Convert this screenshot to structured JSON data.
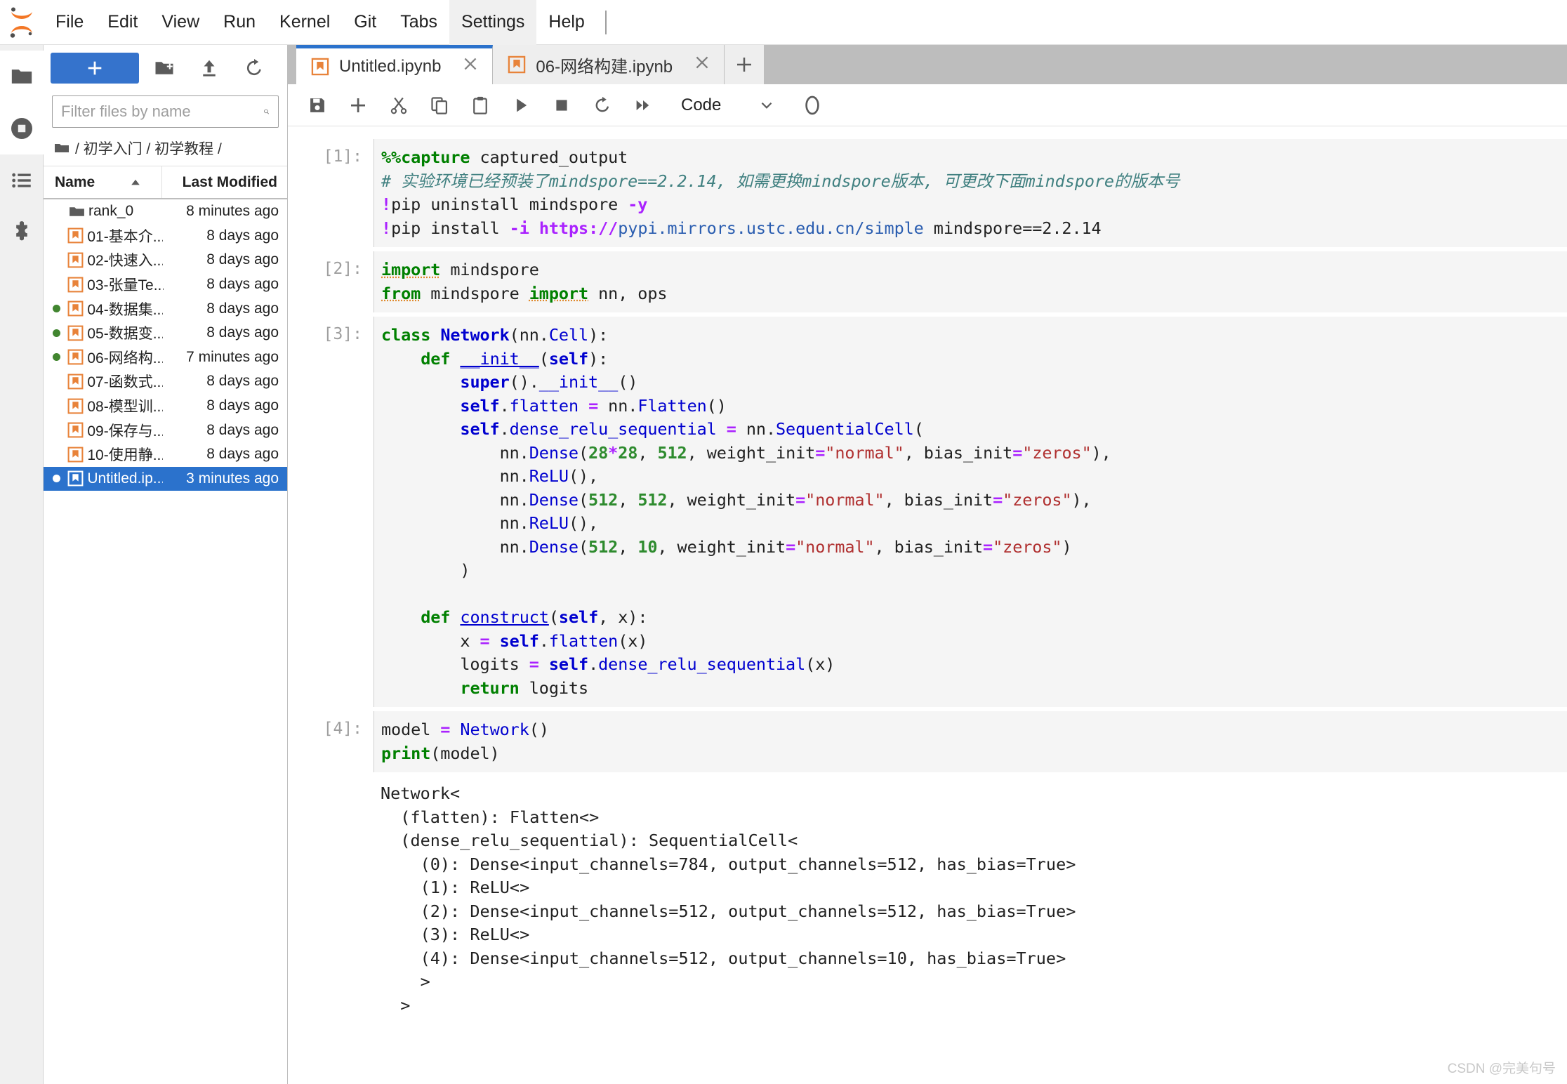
{
  "app": {
    "logo_icon": "jupyter-logo",
    "watermark": "CSDN @完美句号"
  },
  "menubar": {
    "items": [
      {
        "label": "File",
        "active": false
      },
      {
        "label": "Edit",
        "active": false
      },
      {
        "label": "View",
        "active": false
      },
      {
        "label": "Run",
        "active": false
      },
      {
        "label": "Kernel",
        "active": false
      },
      {
        "label": "Git",
        "active": false
      },
      {
        "label": "Tabs",
        "active": false
      },
      {
        "label": "Settings",
        "active": true
      },
      {
        "label": "Help",
        "active": false
      }
    ]
  },
  "activitybar": {
    "items": [
      {
        "name": "file-browser-icon",
        "label": "File Browser",
        "active": false
      },
      {
        "name": "running-kernels-icon",
        "label": "Running Terminals and Kernels",
        "active": true
      },
      {
        "name": "command-palette-icon",
        "label": "Commands",
        "active": false
      },
      {
        "name": "extension-manager-icon",
        "label": "Extension Manager",
        "active": false
      }
    ]
  },
  "filebrowser": {
    "toolbar": {
      "new_launcher_label": "+",
      "new_folder_icon": "new-folder-icon",
      "upload_icon": "upload-icon",
      "refresh_icon": "refresh-icon"
    },
    "filter": {
      "value": "",
      "placeholder": "Filter files by name",
      "search_icon": "search-icon"
    },
    "breadcrumb": {
      "home_icon": "folder-icon",
      "path": "/ 初学入门 / 初学教程 /"
    },
    "columns": {
      "name": "Name",
      "last_modified": "Last Modified",
      "sort_icon": "sort-ascending-icon"
    },
    "files": [
      {
        "name": "rank_0",
        "modified": "8 minutes ago",
        "type": "folder",
        "running": false,
        "selected": false
      },
      {
        "name": "01-基本介...",
        "modified": "8 days ago",
        "type": "notebook",
        "running": false,
        "selected": false
      },
      {
        "name": "02-快速入...",
        "modified": "8 days ago",
        "type": "notebook",
        "running": false,
        "selected": false
      },
      {
        "name": "03-张量Te...",
        "modified": "8 days ago",
        "type": "notebook",
        "running": false,
        "selected": false
      },
      {
        "name": "04-数据集...",
        "modified": "8 days ago",
        "type": "notebook",
        "running": true,
        "selected": false
      },
      {
        "name": "05-数据变...",
        "modified": "8 days ago",
        "type": "notebook",
        "running": true,
        "selected": false
      },
      {
        "name": "06-网络构...",
        "modified": "7 minutes ago",
        "type": "notebook",
        "running": true,
        "selected": false
      },
      {
        "name": "07-函数式...",
        "modified": "8 days ago",
        "type": "notebook",
        "running": false,
        "selected": false
      },
      {
        "name": "08-模型训...",
        "modified": "8 days ago",
        "type": "notebook",
        "running": false,
        "selected": false
      },
      {
        "name": "09-保存与...",
        "modified": "8 days ago",
        "type": "notebook",
        "running": false,
        "selected": false
      },
      {
        "name": "10-使用静...",
        "modified": "8 days ago",
        "type": "notebook",
        "running": false,
        "selected": false
      },
      {
        "name": "Untitled.ip...",
        "modified": "3 minutes ago",
        "type": "notebook",
        "running": true,
        "selected": true
      }
    ]
  },
  "tabs": [
    {
      "label": "Untitled.ipynb",
      "active": true,
      "close_icon": "close-icon"
    },
    {
      "label": "06-网络构建.ipynb",
      "active": false,
      "close_icon": "close-icon"
    }
  ],
  "tab_add_label": "+",
  "notebook_toolbar": {
    "buttons": [
      {
        "name": "save-button",
        "icon": "save-icon"
      },
      {
        "name": "insert-cell-button",
        "icon": "plus-icon"
      },
      {
        "name": "cut-cells-button",
        "icon": "scissors-icon"
      },
      {
        "name": "copy-cells-button",
        "icon": "copy-icon"
      },
      {
        "name": "paste-cells-button",
        "icon": "paste-icon"
      },
      {
        "name": "run-cell-button",
        "icon": "play-icon"
      },
      {
        "name": "interrupt-kernel-button",
        "icon": "stop-icon"
      },
      {
        "name": "restart-kernel-button",
        "icon": "restart-icon"
      },
      {
        "name": "restart-and-run-all-button",
        "icon": "fast-forward-icon"
      }
    ],
    "cell_type": "Code",
    "cell_type_caret": "chevron-down-icon",
    "kernel_status_icon": "kernel-busy-icon"
  },
  "cells": [
    {
      "prompt": "[1]:",
      "kind": "code",
      "lines": [
        "%%capture captured_output",
        "# 实验环境已经预装了mindspore==2.2.14, 如需更换mindspore版本, 可更改下面mindspore的版本号",
        "!pip uninstall mindspore -y",
        "!pip install -i https://pypi.mirrors.ustc.edu.cn/simple mindspore==2.2.14"
      ]
    },
    {
      "prompt": "[2]:",
      "kind": "code",
      "lines": [
        "import mindspore",
        "from mindspore import nn, ops"
      ]
    },
    {
      "prompt": "[3]:",
      "kind": "code",
      "lines": [
        "class Network(nn.Cell):",
        "    def __init__(self):",
        "        super().__init__()",
        "        self.flatten = nn.Flatten()",
        "        self.dense_relu_sequential = nn.SequentialCell(",
        "            nn.Dense(28*28, 512, weight_init=\"normal\", bias_init=\"zeros\"),",
        "            nn.ReLU(),",
        "            nn.Dense(512, 512, weight_init=\"normal\", bias_init=\"zeros\"),",
        "            nn.ReLU(),",
        "            nn.Dense(512, 10, weight_init=\"normal\", bias_init=\"zeros\")",
        "        )",
        "",
        "    def construct(self, x):",
        "        x = self.flatten(x)",
        "        logits = self.dense_relu_sequential(x)",
        "        return logits"
      ]
    },
    {
      "prompt": "[4]:",
      "kind": "code",
      "lines": [
        "model = Network()",
        "print(model)"
      ],
      "output": "Network<\n  (flatten): Flatten<>\n  (dense_relu_sequential): SequentialCell<\n    (0): Dense<input_channels=784, output_channels=512, has_bias=True>\n    (1): ReLU<>\n    (2): Dense<input_channels=512, output_channels=512, has_bias=True>\n    (3): ReLU<>\n    (4): Dense<input_channels=512, output_channels=10, has_bias=True>\n    >\n  >"
    }
  ]
}
